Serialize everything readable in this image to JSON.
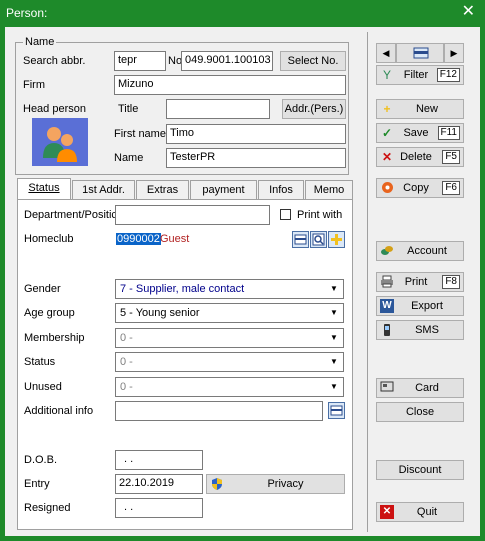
{
  "window": {
    "title": "Person:",
    "close_glyph": "✕"
  },
  "name_group": {
    "label": "Name",
    "search_abbr_label": "Search abbr.",
    "search_abbr_value": "tepr",
    "no_label": "No",
    "no_value": "049.9001.100103",
    "select_no_button": "Select No.",
    "firm_label": "Firm",
    "firm_value": "Mizuno",
    "head_person_label": "Head person",
    "title_label": "Title",
    "title_value": "",
    "addr_pers_button": "Addr.(Pers.)",
    "first_name_label": "First name",
    "first_name_value": "Timo",
    "name_label": "Name",
    "name_value": "TesterPR"
  },
  "tabs": [
    {
      "label": "Status",
      "active": true
    },
    {
      "label": "1st Addr."
    },
    {
      "label": "Extras"
    },
    {
      "label": "payment"
    },
    {
      "label": "Infos"
    },
    {
      "label": "Memo"
    }
  ],
  "status_tab": {
    "department_label": "Department/Positic",
    "department_value": "",
    "print_with_label": "Print with",
    "homeclub_label": "Homeclub",
    "homeclub_code": "0990002",
    "homeclub_name": "Guest",
    "gender_label": "Gender",
    "gender_value": "7 - Supplier, male contact",
    "age_group_label": "Age group",
    "age_group_value": "5 - Young senior",
    "membership_label": "Membership",
    "membership_value": "0 -",
    "status_label": "Status",
    "status_value": "0 -",
    "unused_label": "Unused",
    "unused_value": "0 -",
    "additional_info_label": "Additional info",
    "additional_info_value": "",
    "dob_label": "D.O.B.",
    "dob_value": ". .",
    "entry_label": "Entry",
    "entry_value": "22.10.2019",
    "privacy_button": "Privacy",
    "resigned_label": "Resigned",
    "resigned_value": ". ."
  },
  "sidebar": {
    "filter": {
      "label": "Filter",
      "key": "F12"
    },
    "new": {
      "label": "New"
    },
    "save": {
      "label": "Save",
      "key": "F11"
    },
    "delete": {
      "label": "Delete",
      "key": "F5"
    },
    "copy": {
      "label": "Copy",
      "key": "F6"
    },
    "account": {
      "label": "Account"
    },
    "print": {
      "label": "Print",
      "key": "F8"
    },
    "export": {
      "label": "Export"
    },
    "sms": {
      "label": "SMS"
    },
    "card": {
      "label": "Card"
    },
    "close": {
      "label": "Close"
    },
    "discount": {
      "label": "Discount"
    },
    "quit": {
      "label": "Quit"
    }
  },
  "colors": {
    "titlebar": "#1e8a2a",
    "link_red": "#b22222",
    "highlight": "#0a64c8"
  }
}
